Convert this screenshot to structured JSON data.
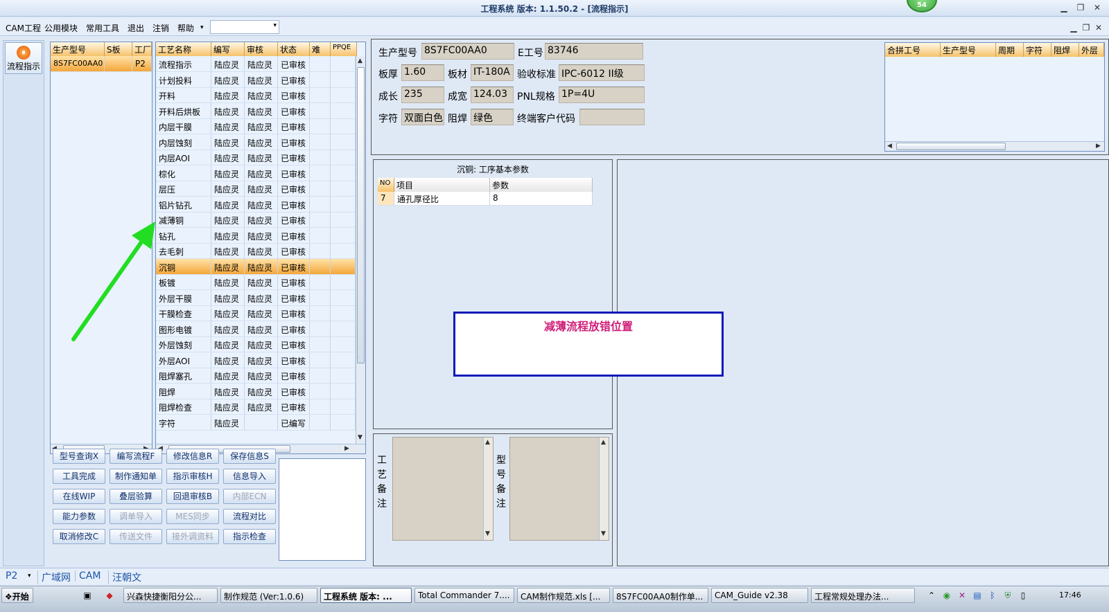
{
  "titlebar": {
    "title": "工程系统  版本: 1.1.50.2 - [流程指示]",
    "badge": "54"
  },
  "menu": {
    "items": [
      "CAM工程",
      "公用模块",
      "常用工具",
      "退出",
      "注销",
      "帮助"
    ],
    "dropdown_arrow": "▾"
  },
  "sidebar": {
    "button_label": "流程指示"
  },
  "model_grid": {
    "headers": [
      "生产型号",
      "S板",
      "工厂"
    ],
    "rows": [
      [
        "8S7FC00AA0",
        "",
        "P2"
      ]
    ]
  },
  "process_grid": {
    "headers": [
      "工艺名称",
      "编写",
      "审核",
      "状态",
      "难",
      "PPQE"
    ],
    "rows": [
      [
        "流程指示",
        "陆应灵",
        "陆应灵",
        "已审核"
      ],
      [
        "计划投料",
        "陆应灵",
        "陆应灵",
        "已审核"
      ],
      [
        "开料",
        "陆应灵",
        "陆应灵",
        "已审核"
      ],
      [
        "开料后烘板",
        "陆应灵",
        "陆应灵",
        "已审核"
      ],
      [
        "内层干膜",
        "陆应灵",
        "陆应灵",
        "已审核"
      ],
      [
        "内层蚀刻",
        "陆应灵",
        "陆应灵",
        "已审核"
      ],
      [
        "内层AOI",
        "陆应灵",
        "陆应灵",
        "已审核"
      ],
      [
        "棕化",
        "陆应灵",
        "陆应灵",
        "已审核"
      ],
      [
        "层压",
        "陆应灵",
        "陆应灵",
        "已审核"
      ],
      [
        "铝片钻孔",
        "陆应灵",
        "陆应灵",
        "已审核"
      ],
      [
        "减薄铜",
        "陆应灵",
        "陆应灵",
        "已审核"
      ],
      [
        "钻孔",
        "陆应灵",
        "陆应灵",
        "已审核"
      ],
      [
        "去毛刺",
        "陆应灵",
        "陆应灵",
        "已审核"
      ],
      [
        "沉铜",
        "陆应灵",
        "陆应灵",
        "已审核"
      ],
      [
        "板镀",
        "陆应灵",
        "陆应灵",
        "已审核"
      ],
      [
        "外层干膜",
        "陆应灵",
        "陆应灵",
        "已审核"
      ],
      [
        "干膜检查",
        "陆应灵",
        "陆应灵",
        "已审核"
      ],
      [
        "图形电镀",
        "陆应灵",
        "陆应灵",
        "已审核"
      ],
      [
        "外层蚀刻",
        "陆应灵",
        "陆应灵",
        "已审核"
      ],
      [
        "外层AOI",
        "陆应灵",
        "陆应灵",
        "已审核"
      ],
      [
        "阻焊塞孔",
        "陆应灵",
        "陆应灵",
        "已审核"
      ],
      [
        "阻焊",
        "陆应灵",
        "陆应灵",
        "已审核"
      ],
      [
        "阻焊检查",
        "陆应灵",
        "陆应灵",
        "已审核"
      ],
      [
        "字符",
        "陆应灵",
        "",
        "已编写"
      ]
    ],
    "selected_row": 13
  },
  "buttons": [
    [
      "型号查询X",
      "编写流程F",
      "修改信息R",
      "保存信息S"
    ],
    [
      "工具完成",
      "制作通知单",
      "指示审核H",
      "信息导入"
    ],
    [
      "在线WIP",
      "叠层验算",
      "回退审核B",
      "内部ECN"
    ],
    [
      "能力参数",
      "调单导入",
      "MES同步",
      "流程对比"
    ],
    [
      "取消修改C",
      "传送文件",
      "接外调资料",
      "指示检查"
    ]
  ],
  "disabled_buttons": [
    "内部ECN",
    "调单导入",
    "MES同步",
    "传送文件",
    "接外调资料"
  ],
  "info": {
    "model_label": "生产型号",
    "model_value": "8S7FC00AA0",
    "e_label": "E工号",
    "e_value": "83746",
    "thick_label": "板厚",
    "thick_value": "1.60",
    "material_label": "板材",
    "material_value": "IT-180A",
    "std_label": "验收标准",
    "std_value": "IPC-6012 II级",
    "len_label": "成长",
    "len_value": "235",
    "width_label": "成宽",
    "width_value": "124.03",
    "pnl_label": "PNL规格",
    "pnl_value": "1P=4U",
    "char_label": "字符",
    "char_value": "双面白色",
    "mask_label": "阻焊",
    "mask_value": "绿色",
    "cust_label": "终端客户代码",
    "cust_value": ""
  },
  "merge_grid": {
    "headers": [
      "合拼工号",
      "生产型号",
      "周期",
      "字符",
      "阻焊",
      "外层"
    ]
  },
  "param_panel": {
    "title": "沉铜: 工序基本参数",
    "headers": [
      "NO",
      "项目",
      "参数"
    ],
    "rows": [
      [
        "7",
        "通孔厚径比",
        "8"
      ]
    ]
  },
  "annotation": {
    "text": "减薄流程放错位置"
  },
  "remarks": {
    "process_label": "工艺备注",
    "model_label": "型号备注"
  },
  "statusbar": {
    "plant": "P2",
    "tabs": [
      "广域网",
      "CAM",
      "汪朝文"
    ]
  },
  "taskbar": {
    "start": "开始",
    "tasks": [
      "兴森快捷衡阳分公...",
      "制作规范 (Ver:1.0.6)",
      "工程系统  版本: ...",
      "Total Commander 7....",
      "CAM制作规范.xls [...",
      "8S7FC00AA0制作单...",
      "CAM_Guide v2.38",
      "工程常规处理办法..."
    ],
    "clock": "17:46"
  },
  "colors": {
    "accent": "#f4a63a",
    "annotation": "#d0207a",
    "arrow": "#22dd22",
    "box_border": "#0a1ab8"
  }
}
